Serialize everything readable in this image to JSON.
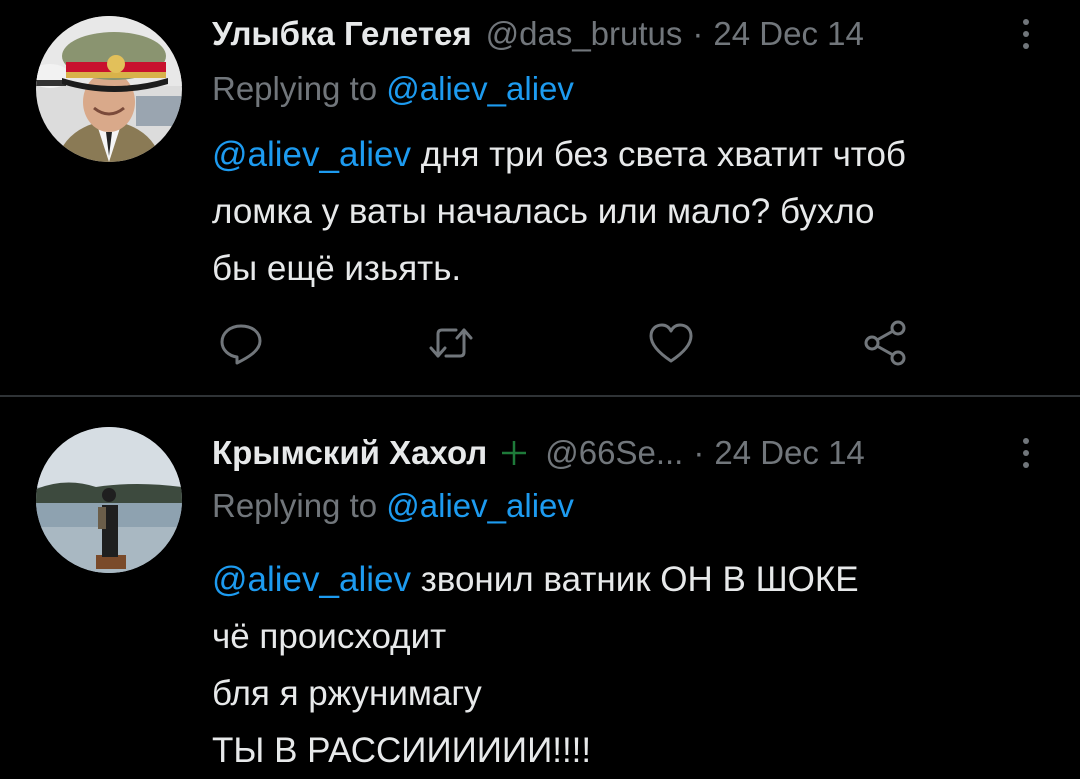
{
  "tweets": [
    {
      "author_name": "Улыбка Гелетея",
      "handle": "@das_brutus",
      "separator": "·",
      "date": "24 Dec 14",
      "replying_prefix": "Replying to",
      "replying_to": "@aliev_aliev",
      "mention": "@aliev_aliev",
      "text_lines": [
        " дня три без света хватит чтоб",
        "ломка у ваты началась или мало? бухло",
        "бы ещё изьять."
      ],
      "actions": [
        "reply-icon",
        "retweet-icon",
        "like-icon",
        "share-icon"
      ]
    },
    {
      "author_name": "Крымский Хахол",
      "handle": "@66Se...",
      "separator": "·",
      "date": "24 Dec 14",
      "replying_prefix": "Replying to",
      "replying_to": "@aliev_aliev",
      "mention": "@aliev_aliev",
      "text_lines": [
        " звонил ватник ОН В ШОКЕ",
        "чё происходит",
        "бля я ржунимагу",
        "ТЫ В РАССИИИИИИ!!!!"
      ]
    }
  ],
  "colors": {
    "background": "#000000",
    "text": "#e7e9ea",
    "secondary": "#71767b",
    "accent": "#1d9bf0",
    "divider": "#2f3336"
  }
}
